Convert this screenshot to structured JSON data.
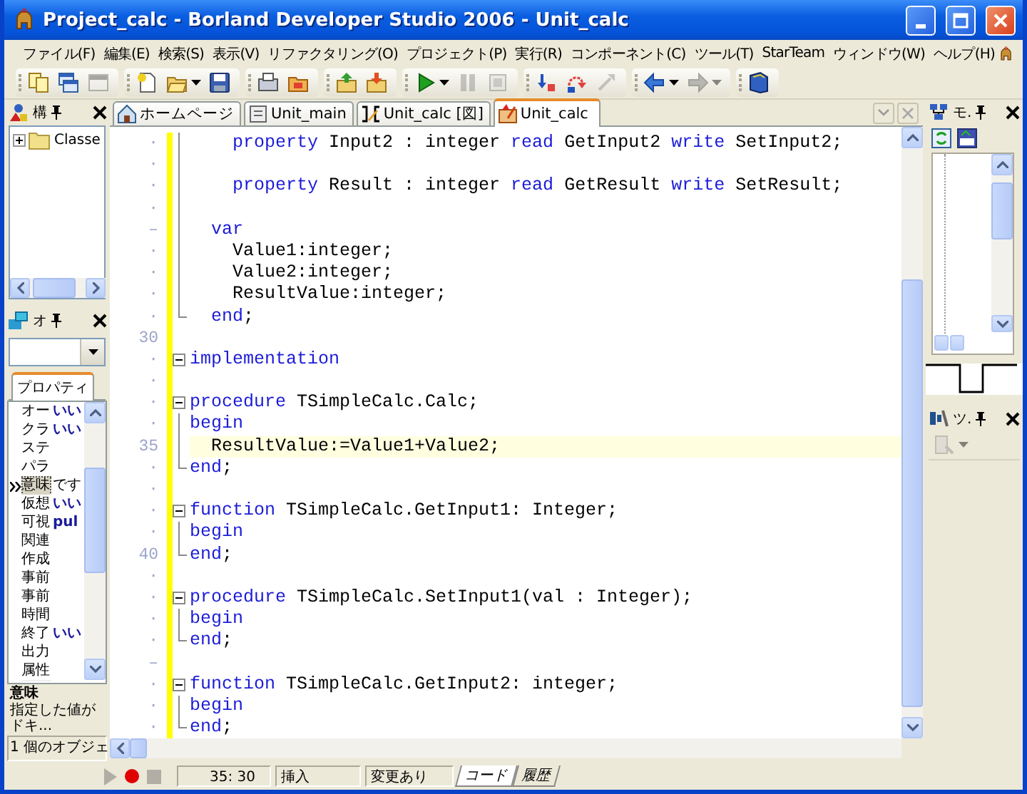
{
  "window": {
    "title": "Project_calc - Borland Developer Studio 2006 - Unit_calc"
  },
  "menu": [
    "ファイル(F)",
    "編集(E)",
    "検索(S)",
    "表示(V)",
    "リファクタリング(O)",
    "プロジェクト(P)",
    "実行(R)",
    "コンポーネント(C)",
    "ツール(T)",
    "StarTeam",
    "ウィンドウ(W)",
    "ヘルプ(H)"
  ],
  "toolbar": [
    [
      {
        "kind": "documents",
        "disabled": false,
        "dropdown": false
      },
      {
        "kind": "windows",
        "disabled": false,
        "dropdown": false
      },
      {
        "kind": "form",
        "disabled": true,
        "dropdown": false
      }
    ],
    [
      {
        "kind": "new",
        "disabled": false,
        "dropdown": false
      },
      {
        "kind": "open",
        "disabled": false,
        "dropdown": true
      },
      {
        "kind": "save",
        "disabled": false,
        "dropdown": false
      }
    ],
    [
      {
        "kind": "stack",
        "disabled": false,
        "dropdown": false
      },
      {
        "kind": "folder",
        "disabled": false,
        "dropdown": false
      }
    ],
    [
      {
        "kind": "add",
        "disabled": false,
        "dropdown": false
      },
      {
        "kind": "remove",
        "disabled": false,
        "dropdown": false
      }
    ],
    [
      {
        "kind": "run",
        "disabled": false,
        "dropdown": true
      },
      {
        "kind": "pause",
        "disabled": true,
        "dropdown": false
      },
      {
        "kind": "stop",
        "disabled": true,
        "dropdown": false
      }
    ],
    [
      {
        "kind": "trace",
        "disabled": false,
        "dropdown": false
      },
      {
        "kind": "step",
        "disabled": false,
        "dropdown": false
      },
      {
        "kind": "run-to",
        "disabled": true,
        "dropdown": false
      }
    ],
    [
      {
        "kind": "back",
        "disabled": false,
        "dropdown": true
      },
      {
        "kind": "forward",
        "disabled": true,
        "dropdown": true
      }
    ],
    [
      {
        "kind": "book",
        "disabled": false,
        "dropdown": false
      }
    ]
  ],
  "structure_panel": {
    "title": "構",
    "tree": [
      {
        "label": "Classe",
        "expanded": false
      }
    ]
  },
  "object_inspector": {
    "title": "オ",
    "tabs": [
      {
        "label": "プロパティ",
        "selected": true
      }
    ],
    "rows": [
      {
        "name": "オー",
        "value": "いい",
        "selected": false
      },
      {
        "name": "クラ",
        "value": "いい",
        "selected": false
      },
      {
        "name": "ステ",
        "selected": false
      },
      {
        "name": "パラ",
        "selected": false
      },
      {
        "name": "意味",
        "value": "です",
        "selected": true
      },
      {
        "name": "仮想",
        "value": "いい",
        "selected": false
      },
      {
        "name": "可視",
        "value": "pul",
        "selected": false
      },
      {
        "name": "関連",
        "selected": false
      },
      {
        "name": "作成",
        "selected": false
      },
      {
        "name": "事前",
        "selected": false
      },
      {
        "name": "事前",
        "selected": false
      },
      {
        "name": "時間",
        "selected": false
      },
      {
        "name": "終了",
        "value": "いい",
        "selected": false
      },
      {
        "name": "出力",
        "selected": false
      },
      {
        "name": "属性",
        "selected": false
      }
    ],
    "description": {
      "title": "意味",
      "text": "指定した値がドキ..."
    },
    "status": "1 個のオブジェ"
  },
  "editor": {
    "tabs": [
      {
        "label": "ホームページ",
        "kind": "home",
        "selected": false
      },
      {
        "label": "Unit_main",
        "kind": "unit",
        "selected": false
      },
      {
        "label": "Unit_calc [図]",
        "kind": "diagram",
        "selected": false
      },
      {
        "label": "Unit_calc",
        "kind": "code",
        "selected": true
      }
    ],
    "lines": [
      {
        "gutter": "·",
        "kind": "fold-inside",
        "modified": true,
        "current": false,
        "segments": [
          {
            "kind": "keyword",
            "text": "    property"
          },
          {
            "kind": "plain",
            "text": " Input2 : integer "
          },
          {
            "kind": "keyword",
            "text": "read"
          },
          {
            "kind": "plain",
            "text": " GetInput2 "
          },
          {
            "kind": "keyword",
            "text": "write"
          },
          {
            "kind": "plain",
            "text": " SetInput2;"
          }
        ]
      },
      {
        "gutter": "·",
        "kind": "fold-inside",
        "modified": true,
        "current": false
      },
      {
        "gutter": "·",
        "kind": "fold-inside",
        "modified": true,
        "current": false,
        "segments": [
          {
            "kind": "keyword",
            "text": "    property"
          },
          {
            "kind": "plain",
            "text": " Result : integer "
          },
          {
            "kind": "keyword",
            "text": "read"
          },
          {
            "kind": "plain",
            "text": " GetResult "
          },
          {
            "kind": "keyword",
            "text": "write"
          },
          {
            "kind": "plain",
            "text": " SetResult;"
          }
        ]
      },
      {
        "gutter": "·",
        "kind": "fold-inside",
        "modified": true,
        "current": false
      },
      {
        "gutter": "–",
        "kind": "fold-inside",
        "modified": true,
        "current": false,
        "segments": [
          {
            "kind": "keyword",
            "text": "  var"
          }
        ]
      },
      {
        "gutter": "·",
        "kind": "fold-inside",
        "modified": true,
        "current": false,
        "segments": [
          {
            "kind": "plain",
            "text": "    Value1:integer;"
          }
        ]
      },
      {
        "gutter": "·",
        "kind": "fold-inside",
        "modified": true,
        "current": false,
        "segments": [
          {
            "kind": "plain",
            "text": "    Value2:integer;"
          }
        ]
      },
      {
        "gutter": "·",
        "kind": "fold-inside",
        "modified": true,
        "current": false,
        "segments": [
          {
            "kind": "plain",
            "text": "    ResultValue:integer;"
          }
        ]
      },
      {
        "gutter": "·",
        "kind": "fold-end",
        "modified": true,
        "current": false,
        "segments": [
          {
            "kind": "keyword",
            "text": "  end"
          },
          {
            "kind": "plain",
            "text": ";"
          }
        ]
      },
      {
        "gutter": "30",
        "kind": "plain",
        "modified": true,
        "current": false
      },
      {
        "gutter": "·",
        "kind": "fold-start",
        "modified": true,
        "current": false,
        "segments": [
          {
            "kind": "keyword",
            "text": "implementation"
          }
        ]
      },
      {
        "gutter": "·",
        "kind": "plain",
        "modified": true,
        "current": false
      },
      {
        "gutter": "·",
        "kind": "fold-start",
        "modified": true,
        "current": false,
        "segments": [
          {
            "kind": "keyword",
            "text": "procedure"
          },
          {
            "kind": "plain",
            "text": " TSimpleCalc.Calc;"
          }
        ]
      },
      {
        "gutter": "·",
        "kind": "fold-inside",
        "modified": true,
        "current": false,
        "segments": [
          {
            "kind": "keyword",
            "text": "begin"
          }
        ]
      },
      {
        "gutter": "35",
        "kind": "fold-inside",
        "modified": true,
        "current": true,
        "segments": [
          {
            "kind": "plain",
            "text": "  ResultValue:=Value1+Value2;"
          }
        ]
      },
      {
        "gutter": "·",
        "kind": "fold-end",
        "modified": true,
        "current": false,
        "segments": [
          {
            "kind": "keyword",
            "text": "end"
          },
          {
            "kind": "plain",
            "text": ";"
          }
        ]
      },
      {
        "gutter": "·",
        "kind": "plain",
        "modified": true,
        "current": false
      },
      {
        "gutter": "·",
        "kind": "fold-start",
        "modified": true,
        "current": false,
        "segments": [
          {
            "kind": "keyword",
            "text": "function"
          },
          {
            "kind": "plain",
            "text": " TSimpleCalc.GetInput1: Integer;"
          }
        ]
      },
      {
        "gutter": "·",
        "kind": "fold-inside",
        "modified": true,
        "current": false,
        "segments": [
          {
            "kind": "keyword",
            "text": "begin"
          }
        ]
      },
      {
        "gutter": "40",
        "kind": "fold-end",
        "modified": true,
        "current": false,
        "segments": [
          {
            "kind": "keyword",
            "text": "end"
          },
          {
            "kind": "plain",
            "text": ";"
          }
        ]
      },
      {
        "gutter": "·",
        "kind": "plain",
        "modified": true,
        "current": false
      },
      {
        "gutter": "·",
        "kind": "fold-start",
        "modified": true,
        "current": false,
        "segments": [
          {
            "kind": "keyword",
            "text": "procedure"
          },
          {
            "kind": "plain",
            "text": " TSimpleCalc.SetInput1(val : Integer);"
          }
        ]
      },
      {
        "gutter": "·",
        "kind": "fold-inside",
        "modified": true,
        "current": false,
        "segments": [
          {
            "kind": "keyword",
            "text": "begin"
          }
        ]
      },
      {
        "gutter": "·",
        "kind": "fold-end",
        "modified": true,
        "current": false,
        "segments": [
          {
            "kind": "keyword",
            "text": "end"
          },
          {
            "kind": "plain",
            "text": ";"
          }
        ]
      },
      {
        "gutter": "–",
        "kind": "plain",
        "modified": true,
        "current": false
      },
      {
        "gutter": "·",
        "kind": "fold-start",
        "modified": true,
        "current": false,
        "segments": [
          {
            "kind": "keyword",
            "text": "function"
          },
          {
            "kind": "plain",
            "text": " TSimpleCalc.GetInput2: integer;"
          }
        ]
      },
      {
        "gutter": "·",
        "kind": "fold-inside",
        "modified": true,
        "current": false,
        "segments": [
          {
            "kind": "keyword",
            "text": "begin"
          }
        ]
      },
      {
        "gutter": "·",
        "kind": "fold-end",
        "modified": true,
        "current": false,
        "segments": [
          {
            "kind": "keyword",
            "text": "end"
          },
          {
            "kind": "plain",
            "text": ";"
          }
        ]
      }
    ]
  },
  "model_view": {
    "title": "モ."
  },
  "tool_palette": {
    "title": "ツ."
  },
  "status_bar": {
    "position": "35: 30",
    "mode": "挿入",
    "modified": "変更あり",
    "tabs": [
      {
        "label": "コード",
        "selected": true
      },
      {
        "label": "履歴",
        "selected": false
      }
    ]
  }
}
